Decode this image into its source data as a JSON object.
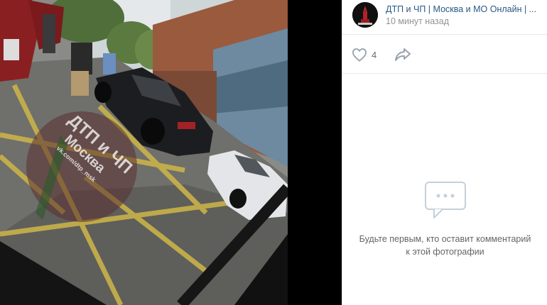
{
  "post": {
    "group_name": "ДТП и ЧП | Москва и МО Онлайн | ...",
    "time": "10 минут назад",
    "likes": "4"
  },
  "photo": {
    "watermark_line1": "ДТП и ЧП",
    "watermark_line2": "Москва",
    "watermark_line3": "vk.com/dtp_msk"
  },
  "comments": {
    "empty_text": "Будьте первым, кто оставит комментарий к этой фотографии"
  },
  "icons": {
    "like": "heart-icon",
    "share": "share-icon",
    "empty": "comments-icon"
  },
  "colors": {
    "link": "#2a5885",
    "muted": "#939393",
    "icon": "#99a2ad",
    "panel_bg": "#ffffff",
    "viewer_bg": "#000000"
  }
}
